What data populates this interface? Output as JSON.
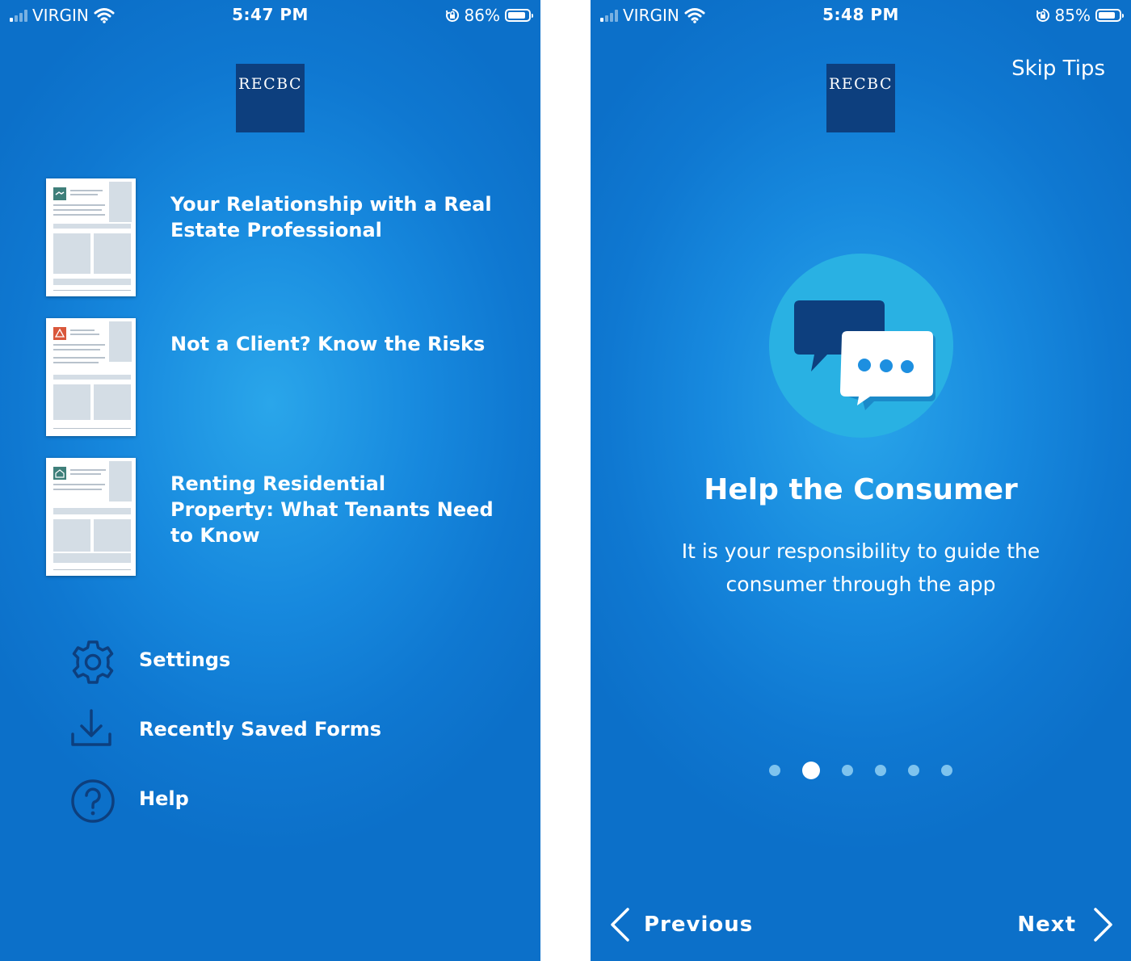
{
  "colors": {
    "background": "#1789de",
    "logo_bg": "#0d3f7e",
    "icon_dark": "#0d3f7e",
    "circle": "#29b1e3",
    "dot_inactive": "#7ec3ee"
  },
  "left": {
    "status": {
      "carrier": "VIRGIN",
      "time": "5:47 PM",
      "battery": "86%",
      "battery_level": 0.86
    },
    "logo_text": "RECBC",
    "documents": [
      {
        "title": "Your Relationship with a Real Estate Professional",
        "thumb_icon": "handshake-icon",
        "thumb_accent": "#3f7f7a"
      },
      {
        "title": "Not a Client? Know the Risks",
        "thumb_icon": "warning-icon",
        "thumb_accent": "#d9573b"
      },
      {
        "title": "Renting Residential Property: What Tenants Need to Know",
        "thumb_icon": "house-key-icon",
        "thumb_accent": "#3f7f7a"
      }
    ],
    "menu": [
      {
        "label": "Settings",
        "icon": "gear-icon"
      },
      {
        "label": "Recently Saved Forms",
        "icon": "download-icon"
      },
      {
        "label": "Help",
        "icon": "question-circle-icon"
      }
    ]
  },
  "right": {
    "status": {
      "carrier": "VIRGIN",
      "time": "5:48 PM",
      "battery": "85%",
      "battery_level": 0.85
    },
    "logo_text": "RECBC",
    "skip_label": "Skip Tips",
    "illustration": "chat-bubbles-icon",
    "title": "Help the Consumer",
    "body": "It is your responsibility to guide the consumer through the app",
    "page_dots": {
      "count": 6,
      "active_index": 1
    },
    "prev_label": "Previous",
    "next_label": "Next"
  }
}
